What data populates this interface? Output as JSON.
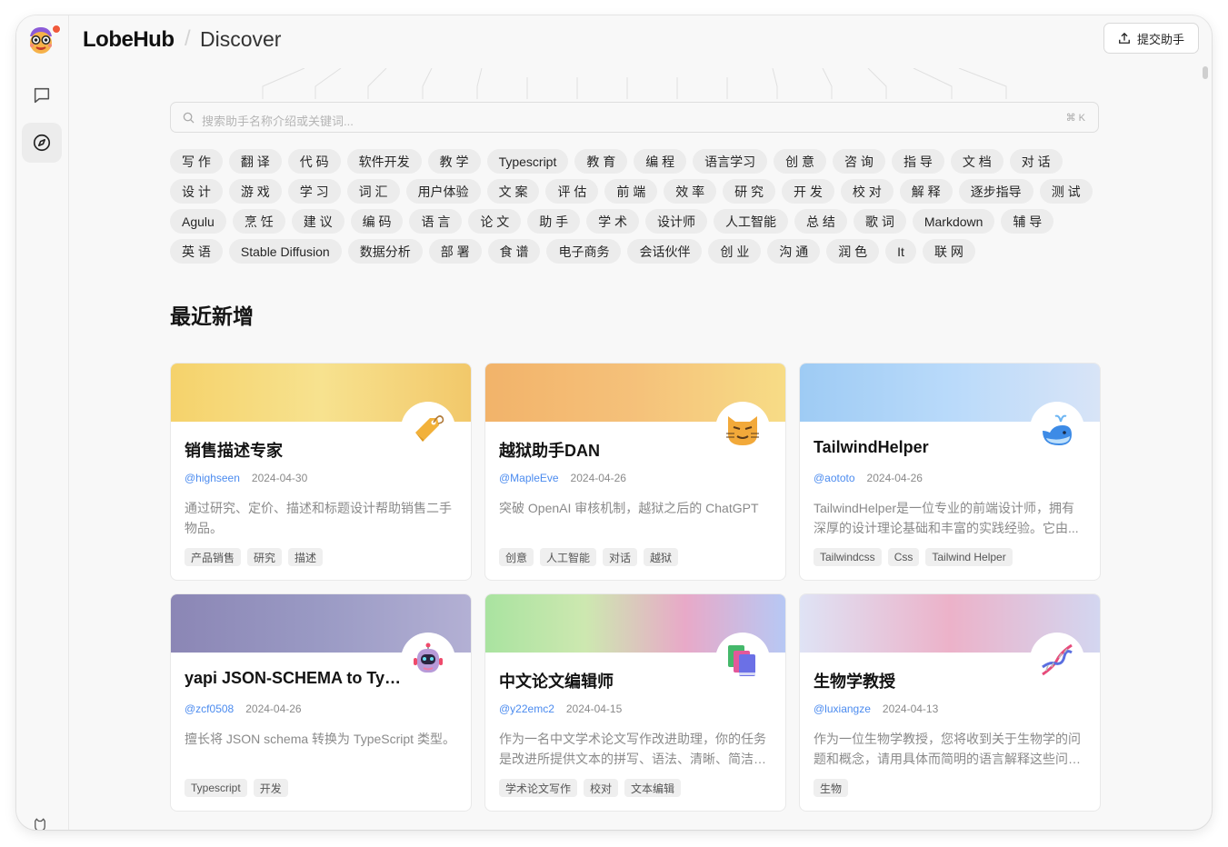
{
  "app": {
    "brand": "LobeHub",
    "separator": "/",
    "section": "Discover",
    "submit_label": "提交助手"
  },
  "sidebar": {
    "items": [
      {
        "icon": "chat-bubble-icon",
        "active": false
      },
      {
        "icon": "compass-icon",
        "active": true
      }
    ],
    "footer_icon": "github-icon"
  },
  "search": {
    "placeholder": "搜索助手名称介绍或关键词...",
    "shortcut": "⌘ K"
  },
  "tags": [
    "写 作",
    "翻 译",
    "代 码",
    "软件开发",
    "教 学",
    "Typescript",
    "教 育",
    "编 程",
    "语言学习",
    "创 意",
    "咨 询",
    "指 导",
    "文 档",
    "对 话",
    "设 计",
    "游 戏",
    "学 习",
    "词 汇",
    "用户体验",
    "文 案",
    "评 估",
    "前 端",
    "效 率",
    "研 究",
    "开 发",
    "校 对",
    "解 释",
    "逐步指导",
    "测 试",
    "Agulu",
    "烹 饪",
    "建 议",
    "编 码",
    "语 言",
    "论 文",
    "助 手",
    "学 术",
    "设计师",
    "人工智能",
    "总 结",
    "歌 词",
    "Markdown",
    "辅 导",
    "英 语",
    "Stable Diffusion",
    "数据分析",
    "部 署",
    "食 谱",
    "电子商务",
    "会话伙伴",
    "创 业",
    "沟 通",
    "润 色",
    "It",
    "联 网"
  ],
  "recent": {
    "title": "最近新增",
    "cards": [
      {
        "title": "销售描述专家",
        "author": "@highseen",
        "date": "2024-04-30",
        "desc": "通过研究、定价、描述和标题设计帮助销售二手物品。",
        "tags": [
          "产品销售",
          "研究",
          "描述"
        ],
        "emoji": "label-tag-icon",
        "banner": [
          "#f5d26b",
          "#f7e28f",
          "#f2c86a"
        ]
      },
      {
        "title": "越狱助手DAN",
        "author": "@MapleEve",
        "date": "2024-04-26",
        "desc": "突破 OpenAI 审核机制，越狱之后的 ChatGPT",
        "tags": [
          "创意",
          "人工智能",
          "对话",
          "越狱"
        ],
        "emoji": "smirking-cat-icon",
        "banner": [
          "#f2b36a",
          "#f5c17a",
          "#f7dc86"
        ]
      },
      {
        "title": "TailwindHelper",
        "author": "@aototo",
        "date": "2024-04-26",
        "desc": "TailwindHelper是一位专业的前端设计师，拥有深厚的设计理论基础和丰富的实践经验。它由...",
        "tags": [
          "Tailwindcss",
          "Css",
          "Tailwind Helper"
        ],
        "emoji": "whale-icon",
        "banner": [
          "#9ecbf4",
          "#b9dafa",
          "#d8e4f7"
        ]
      },
      {
        "title": "yapi JSON-SCHEMA to TypeScript",
        "author": "@zcf0508",
        "date": "2024-04-26",
        "desc": "擅长将 JSON schema 转换为 TypeScript 类型。",
        "tags": [
          "Typescript",
          "开发"
        ],
        "emoji": "robot-icon",
        "banner": [
          "#8b86b5",
          "#9a9ac4",
          "#b3b0d4"
        ]
      },
      {
        "title": "中文论文编辑师",
        "author": "@y22emc2",
        "date": "2024-04-15",
        "desc": "作为一名中文学术论文写作改进助理，你的任务是改进所提供文本的拼写、语法、清晰、简洁和整体可读性。",
        "tags": [
          "学术论文写作",
          "校对",
          "文本编辑"
        ],
        "emoji": "books-icon",
        "banner": [
          "#a9e3a0",
          "#cde8b0",
          "#e8a9c8",
          "#b7c8f4"
        ]
      },
      {
        "title": "生物学教授",
        "author": "@luxiangze",
        "date": "2024-04-13",
        "desc": "作为一位生物学教授，您将收到关于生物学的问题和概念，请用具体而简明的语言解释这些问题。",
        "tags": [
          "生物"
        ],
        "emoji": "dna-icon",
        "banner": [
          "#dfe3f5",
          "#ecb2c9",
          "#d3d6f0"
        ]
      }
    ]
  }
}
